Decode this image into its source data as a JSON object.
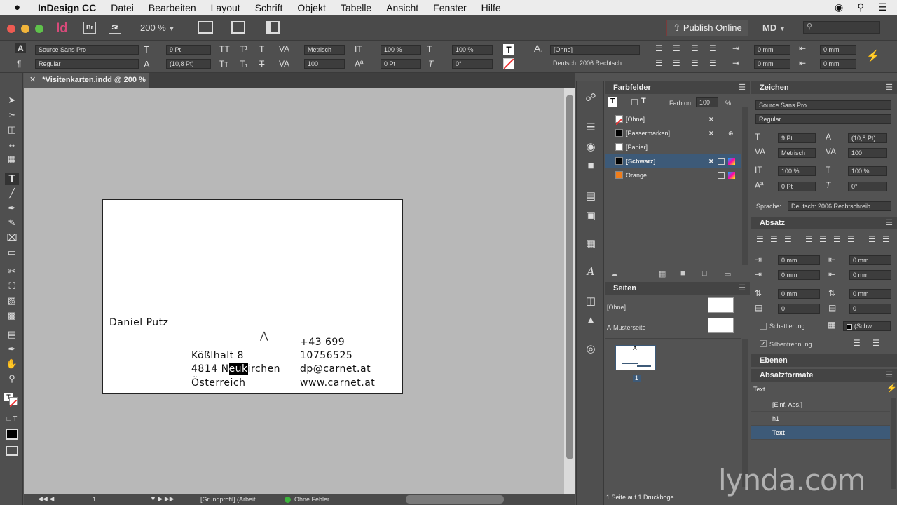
{
  "menubar": {
    "apple": "",
    "items": [
      "InDesign CC",
      "Datei",
      "Bearbeiten",
      "Layout",
      "Schrift",
      "Objekt",
      "Tabelle",
      "Ansicht",
      "Fenster",
      "Hilfe"
    ]
  },
  "appbar": {
    "logo": "Id",
    "bridge": "Br",
    "stock": "St",
    "zoom": "200 %",
    "publish": "Publish Online",
    "user": "MD"
  },
  "control": {
    "font_family": "Source Sans Pro",
    "font_style": "Regular",
    "font_size": "9 Pt",
    "leading": "(10,8 Pt)",
    "kerning": "Metrisch",
    "tracking": "100",
    "vscale": "100 %",
    "hscale": "100 %",
    "baseline": "0 Pt",
    "skew": "0°",
    "char_style": "[Ohne]",
    "language": "Deutsch: 2006 Rechtsch...",
    "indent1": "0 mm",
    "indent2": "0 mm",
    "indent3": "0 mm",
    "indent4": "0 mm"
  },
  "document": {
    "tab": "*Visitenkarten.indd @ 200 %",
    "name": "Daniel Putz",
    "address": [
      "Kößlhalt 8",
      "4814 Neukirchen",
      "Österreich"
    ],
    "address_line2_parts": [
      "4814 N",
      "euk",
      "irchen"
    ],
    "contact": [
      "+43 699",
      "10756525",
      "dp@carnet.at",
      "www.carnet.at"
    ]
  },
  "statusbar": {
    "page": "1",
    "profile": "[Grundprofil] (Arbeit...",
    "errors": "Ohne Fehler"
  },
  "farbfelder": {
    "title": "Farbfelder",
    "farbton_label": "Farbton:",
    "farbton": "100",
    "pct": "%",
    "swatches": [
      {
        "name": "[Ohne]",
        "color": "#ffffff"
      },
      {
        "name": "[Passermarken]",
        "color": "#000000"
      },
      {
        "name": "[Papier]",
        "color": "#ffffff"
      },
      {
        "name": "[Schwarz]",
        "color": "#000000"
      },
      {
        "name": "Orange",
        "color": "#f07d1a"
      }
    ]
  },
  "seiten": {
    "title": "Seiten",
    "none": "[Ohne]",
    "master": "A-Musterseite",
    "master_letter": "A",
    "page_num": "1",
    "footer": "1 Seite auf 1 Druckboge"
  },
  "zeichen": {
    "title": "Zeichen",
    "font_family": "Source Sans Pro",
    "font_style": "Regular",
    "size": "9 Pt",
    "leading": "(10,8 Pt)",
    "kerning": "Metrisch",
    "tracking": "100",
    "vscale": "100 %",
    "hscale": "100 %",
    "baseline": "0 Pt",
    "skew": "0°",
    "lang_label": "Sprache:",
    "language": "Deutsch: 2006 Rechtschreib..."
  },
  "absatz": {
    "title": "Absatz",
    "v1": "0 mm",
    "v2": "0 mm",
    "v3": "0 mm",
    "v4": "0 mm",
    "v5": "0 mm",
    "v6": "0 mm",
    "v7": "0",
    "v8": "0",
    "shading": "Schattierung",
    "shading_color": "(Schw...",
    "hyphen": "Silbentrennung"
  },
  "ebenen": {
    "title": "Ebenen"
  },
  "absatzformate": {
    "title": "Absatzformate",
    "current": "Text",
    "styles": [
      "[Einf. Abs.]",
      "h1",
      "Text"
    ]
  },
  "watermark": "lynda.com"
}
